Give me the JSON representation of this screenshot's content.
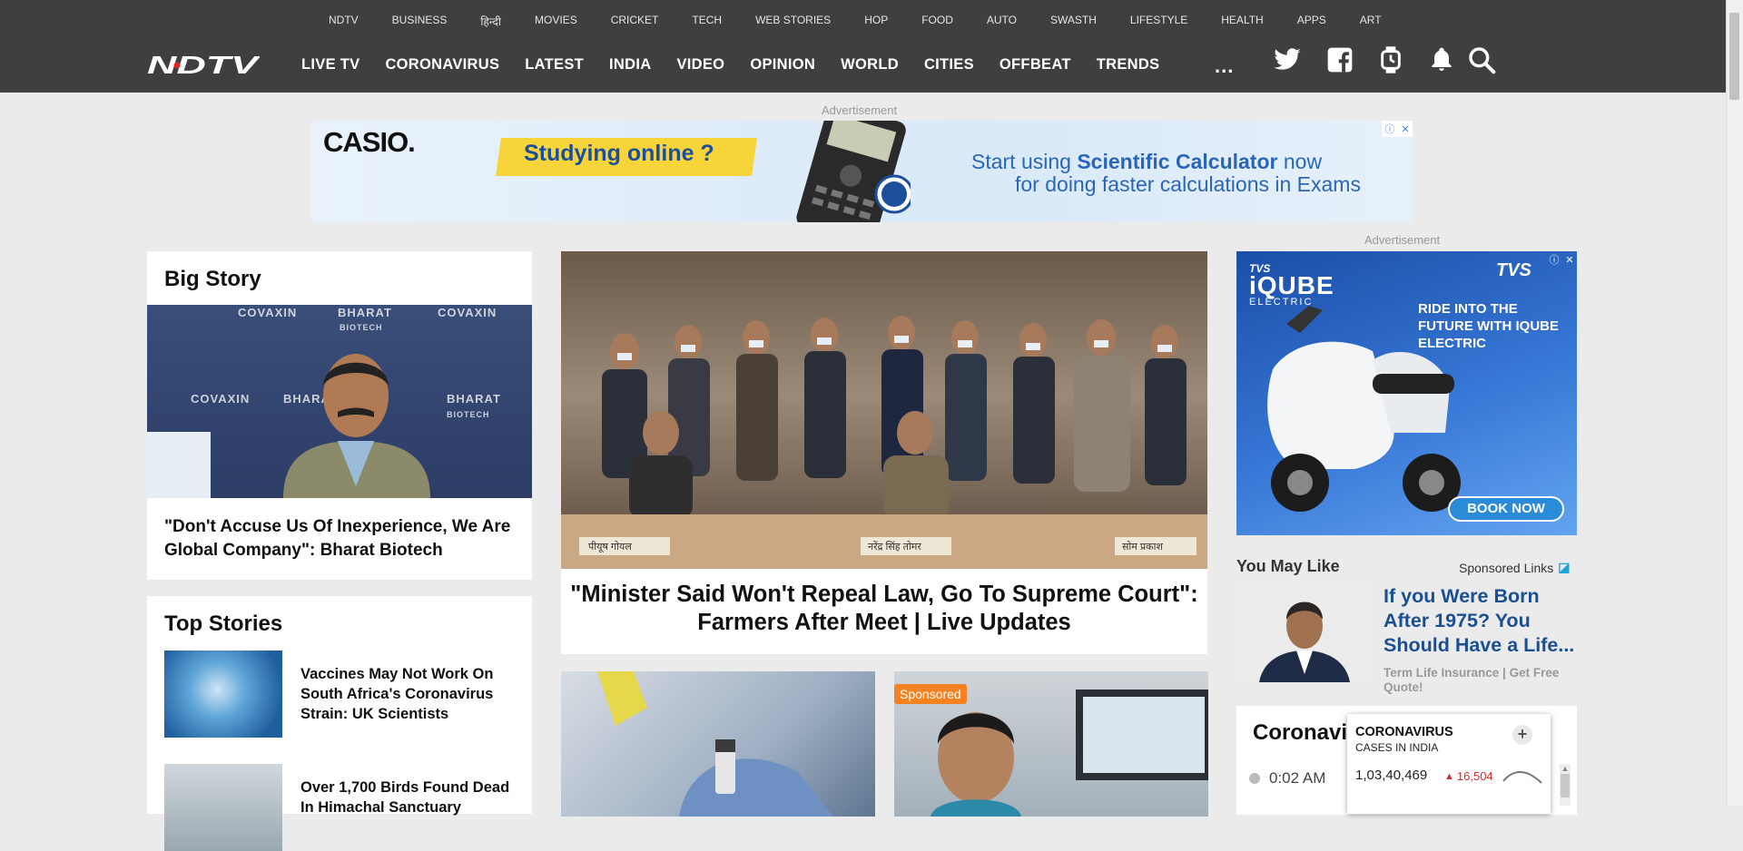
{
  "topnav": [
    "NDTV",
    "BUSINESS",
    "हिन्दी",
    "MOVIES",
    "CRICKET",
    "TECH",
    "WEB STORIES",
    "HOP",
    "FOOD",
    "AUTO",
    "SWASTH",
    "LIFESTYLE",
    "HEALTH",
    "APPS",
    "ART"
  ],
  "logo": "NDTV",
  "mainnav": [
    "LIVE TV",
    "CORONAVIRUS",
    "LATEST",
    "INDIA",
    "VIDEO",
    "OPINION",
    "WORLD",
    "CITIES",
    "OFFBEAT",
    "TRENDS"
  ],
  "more": "...",
  "icons": [
    "twitter-icon",
    "facebook-icon",
    "smartwatch-icon",
    "bell-icon",
    "search-icon"
  ],
  "ad_label": "Advertisement",
  "banner": {
    "brand": "CASIO.",
    "tagline": "Studying online ?",
    "line1_pre": "Start using ",
    "line1_bold": "Scientific Calculator",
    "line1_post": " now",
    "line2": "for doing faster calculations in Exams"
  },
  "big_story": {
    "heading": "Big Story",
    "headline": "\"Don't Accuse Us Of Inexperience, We Are Global Company\": Bharat Biotech",
    "bg_words": [
      "COVAXIN",
      "BHARAT",
      "BIOTECH"
    ]
  },
  "main_story": {
    "headline": "\"Minister Said Won't Repeal Law, Go To Supreme Court\": Farmers After Meet | Live Updates",
    "plaque_words": [
      "पीयूष गोयल",
      "नरेंद्र सिंह तोमर",
      "सोम प्रकाश"
    ]
  },
  "top_stories": {
    "heading": "Top Stories",
    "items": [
      {
        "title": "Vaccines May Not Work On South Africa's Coronavirus Strain: UK Scientists"
      },
      {
        "title": "Over 1,700 Birds Found Dead In Himachal Sanctuary"
      }
    ]
  },
  "sponsored_label": "Sponsored",
  "tvs_ad": {
    "brand": "TVS",
    "product": "iQUBE",
    "product_sub": "ELECTRIC",
    "tagline": "RIDE INTO THE FUTURE WITH IQUBE ELECTRIC",
    "cta": "BOOK NOW"
  },
  "you_may_like": {
    "heading": "You May Like",
    "sponsored_links": "Sponsored Links",
    "title": "If you Were Born After 1975? You Should Have a Life...",
    "subtitle": "Term Life Insurance | Get Free Quote!"
  },
  "coronavirus": {
    "title": "Coronavirus",
    "time": "0:02 AM",
    "widget_title": "CORONAVIRUS",
    "widget_sub": "CASES IN INDIA",
    "cases": "1,03,40,469",
    "delta": "16,504"
  }
}
